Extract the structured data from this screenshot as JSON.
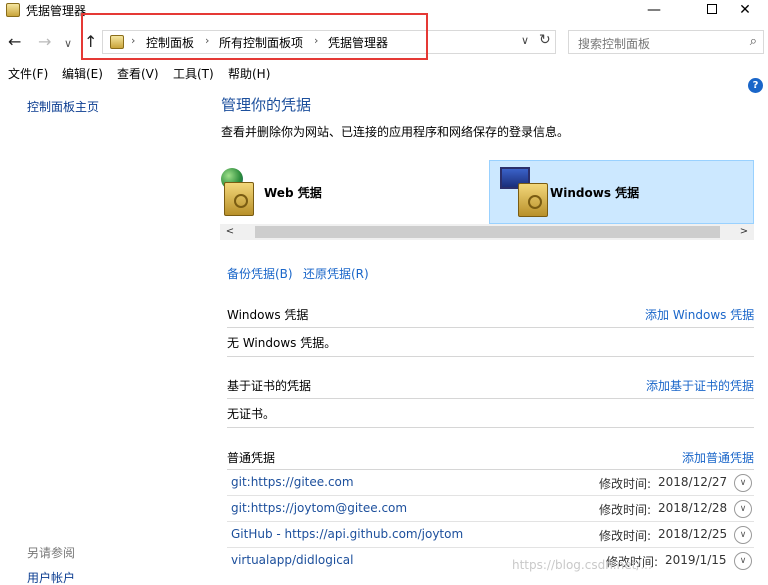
{
  "window": {
    "title": "凭据管理器",
    "min_symbol": "—",
    "close_symbol": "✕"
  },
  "nav": {
    "back_symbol": "←",
    "forward_symbol": "→",
    "recent_symbol": "∨",
    "up_symbol": "↑",
    "breadcrumb": [
      "控制面板",
      "所有控制面板项",
      "凭据管理器"
    ],
    "breadcrumb_separator": "›",
    "dropdown_symbol": "∨",
    "refresh_symbol": "↻",
    "search_placeholder": "搜索控制面板",
    "search_icon": "search-icon"
  },
  "menu": {
    "items": [
      "文件(F)",
      "编辑(E)",
      "查看(V)",
      "工具(T)",
      "帮助(H)"
    ]
  },
  "sidebar": {
    "home_link": "控制面板主页",
    "see_also_heading": "另请参阅",
    "user_accounts_link": "用户帐户"
  },
  "main": {
    "help_symbol": "?",
    "title": "管理你的凭据",
    "description": "查看并删除你为网站、已连接的应用程序和网络保存的登录信息。",
    "tabs": [
      {
        "label": "Web 凭据",
        "selected": false
      },
      {
        "label": "Windows 凭据",
        "selected": true
      }
    ],
    "scroll_left": "<",
    "scroll_right": ">",
    "backup_link": "备份凭据(B)",
    "restore_link": "还原凭据(R)",
    "windows_section": {
      "title": "Windows 凭据",
      "add_link": "添加 Windows 凭据",
      "empty_text": "无 Windows 凭据。"
    },
    "cert_section": {
      "title": "基于证书的凭据",
      "add_link": "添加基于证书的凭据",
      "empty_text": "无证书。"
    },
    "generic_section": {
      "title": "普通凭据",
      "add_link": "添加普通凭据",
      "modified_label": "修改时间:",
      "expand_symbol": "∨",
      "items": [
        {
          "name": "git:https://gitee.com",
          "date": "2018/12/27"
        },
        {
          "name": "git:https://joytom@gitee.com",
          "date": "2018/12/28"
        },
        {
          "name": "GitHub - https://api.github.com/joytom",
          "date": "2018/12/25"
        },
        {
          "name": "virtualapp/didlogical",
          "date": "2019/1/15"
        }
      ]
    }
  },
  "watermark": "https://blog.csdn.net/..."
}
